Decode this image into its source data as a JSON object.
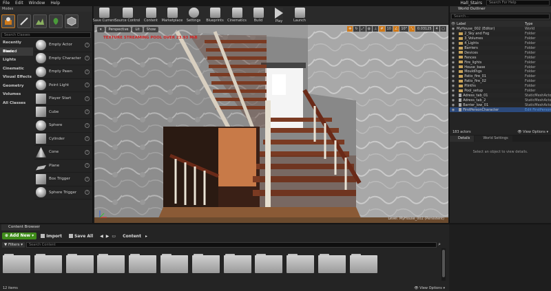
{
  "menu": {
    "items": [
      "File",
      "Edit",
      "Window",
      "Help"
    ],
    "project": "Hall_Stairs",
    "search_help": "Search For Help"
  },
  "modes": {
    "tab": "Modes",
    "search_placeholder": "Search Classes",
    "categories": [
      "Recently Placed",
      "Basic",
      "Lights",
      "Cinematic",
      "Visual Effects",
      "Geometry",
      "Volumes",
      "All Classes"
    ],
    "items": [
      "Empty Actor",
      "Empty Character",
      "Empty Pawn",
      "Point Light",
      "Player Start",
      "Cube",
      "Sphere",
      "Cylinder",
      "Cone",
      "Plane",
      "Box Trigger",
      "Sphere Trigger"
    ]
  },
  "toolbar": {
    "buttons": [
      "Save Current",
      "Source Control",
      "Content",
      "Marketplace",
      "Settings",
      "Blueprints",
      "Cinematics",
      "Build",
      "Play",
      "Launch"
    ]
  },
  "viewport": {
    "perspective": "Perspective",
    "lit": "Lit",
    "show": "Show",
    "warning": "TEXTURE STREAMING POOL OVER 23.93 MiB",
    "snap_angle": "10°",
    "scale_snap": "0.03125",
    "camera_speed": "4",
    "level": "Level:  MyHouse_002 (Persistent)"
  },
  "outliner": {
    "tab": "World Outliner",
    "search_placeholder": "Search...",
    "col_label": "Label",
    "col_type": "Type",
    "rows": [
      {
        "label": "MyHouse_002 (Editor)",
        "type": "World"
      },
      {
        "label": "2_Sky and Fog",
        "type": "Folder"
      },
      {
        "label": "3_Volumes",
        "type": "Folder"
      },
      {
        "label": "4_Lights",
        "type": "Folder"
      },
      {
        "label": "Barriers",
        "type": "Folder"
      },
      {
        "label": "Devices",
        "type": "Folder"
      },
      {
        "label": "Fences",
        "type": "Folder"
      },
      {
        "label": "Fire_lights",
        "type": "Folder"
      },
      {
        "label": "House_base",
        "type": "Folder"
      },
      {
        "label": "Mouldings",
        "type": "Folder"
      },
      {
        "label": "Patio_fire_01",
        "type": "Folder"
      },
      {
        "label": "Patio_fire_02",
        "type": "Folder"
      },
      {
        "label": "Plinths",
        "type": "Folder"
      },
      {
        "label": "Pool_setup",
        "type": "Folder"
      },
      {
        "label": "Adress_tab_01",
        "type": "StaticMeshActor"
      },
      {
        "label": "Adress_tab_2",
        "type": "StaticMeshActor"
      },
      {
        "label": "Barrier_low_01",
        "type": "StaticMeshActor"
      },
      {
        "label": "FirstPersonCharacter",
        "type": "Edit FirstPerson"
      }
    ],
    "count": "183 actors",
    "view_options": "View Options"
  },
  "details": {
    "tab_details": "Details",
    "tab_world": "World Settings",
    "empty": "Select an object to view details."
  },
  "content_browser": {
    "tab": "Content Browser",
    "add_new": "Add New",
    "import": "Import",
    "save_all": "Save All",
    "path": "Content",
    "filters": "Filters",
    "search_placeholder": "Search Content",
    "item_count": "12 items",
    "view_options": "View Options",
    "folders": 12
  }
}
